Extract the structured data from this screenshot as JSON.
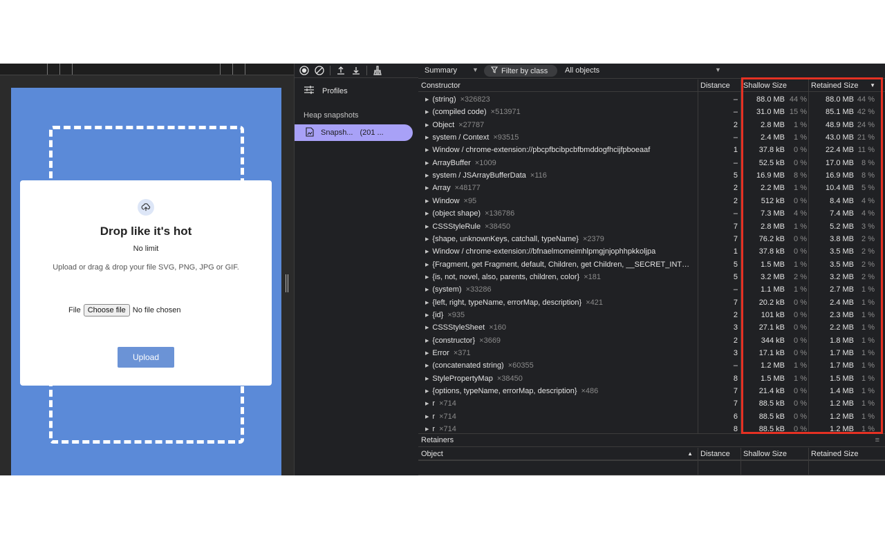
{
  "modal": {
    "title": "Drop like it's hot",
    "limit": "No limit",
    "description": "Upload or drag & drop your file SVG, PNG, JPG or GIF.",
    "file_label": "File",
    "choose_file": "Choose file",
    "no_file": "No file chosen",
    "upload": "Upload"
  },
  "sidebar": {
    "profiles": "Profiles",
    "heap_snapshots": "Heap snapshots",
    "snapshot_name": "Snapsh...",
    "snapshot_size": "(201 ..."
  },
  "toolbar": {
    "view": "Summary",
    "filter": "Filter by class",
    "objects": "All objects"
  },
  "headers": {
    "constructor": "Constructor",
    "distance": "Distance",
    "shallow": "Shallow Size",
    "retained": "Retained Size",
    "object": "Object"
  },
  "retainers_title": "Retainers",
  "rows": [
    {
      "name": "(string)",
      "count": "×326823",
      "distance": "–",
      "shallow": "88.0 MB",
      "shallow_pct": "44 %",
      "retained": "88.0 MB",
      "retained_pct": "44 %"
    },
    {
      "name": "(compiled code)",
      "count": "×513971",
      "distance": "–",
      "shallow": "31.0 MB",
      "shallow_pct": "15 %",
      "retained": "85.1 MB",
      "retained_pct": "42 %"
    },
    {
      "name": "Object",
      "count": "×27787",
      "distance": "2",
      "shallow": "2.8 MB",
      "shallow_pct": "1 %",
      "retained": "48.9 MB",
      "retained_pct": "24 %"
    },
    {
      "name": "system / Context",
      "count": "×93515",
      "distance": "–",
      "shallow": "2.4 MB",
      "shallow_pct": "1 %",
      "retained": "43.0 MB",
      "retained_pct": "21 %"
    },
    {
      "name": "Window / chrome-extension://pbcpfbcibpcbfbmddogfhcijfpboeaaf",
      "count": "",
      "distance": "1",
      "shallow": "37.8 kB",
      "shallow_pct": "0 %",
      "retained": "22.4 MB",
      "retained_pct": "11 %"
    },
    {
      "name": "ArrayBuffer",
      "count": "×1009",
      "distance": "–",
      "shallow": "52.5 kB",
      "shallow_pct": "0 %",
      "retained": "17.0 MB",
      "retained_pct": "8 %"
    },
    {
      "name": "system / JSArrayBufferData",
      "count": "×116",
      "distance": "5",
      "shallow": "16.9 MB",
      "shallow_pct": "8 %",
      "retained": "16.9 MB",
      "retained_pct": "8 %"
    },
    {
      "name": "Array",
      "count": "×48177",
      "distance": "2",
      "shallow": "2.2 MB",
      "shallow_pct": "1 %",
      "retained": "10.4 MB",
      "retained_pct": "5 %"
    },
    {
      "name": "Window",
      "count": "×95",
      "distance": "2",
      "shallow": "512 kB",
      "shallow_pct": "0 %",
      "retained": "8.4 MB",
      "retained_pct": "4 %"
    },
    {
      "name": "(object shape)",
      "count": "×136786",
      "distance": "–",
      "shallow": "7.3 MB",
      "shallow_pct": "4 %",
      "retained": "7.4 MB",
      "retained_pct": "4 %"
    },
    {
      "name": "CSSStyleRule",
      "count": "×38450",
      "distance": "7",
      "shallow": "2.8 MB",
      "shallow_pct": "1 %",
      "retained": "5.2 MB",
      "retained_pct": "3 %"
    },
    {
      "name": "{shape, unknownKeys, catchall, typeName}",
      "count": "×2379",
      "distance": "7",
      "shallow": "76.2 kB",
      "shallow_pct": "0 %",
      "retained": "3.8 MB",
      "retained_pct": "2 %"
    },
    {
      "name": "Window / chrome-extension://bfnaelmomeimhlpmgjnjophhpkkoljpa",
      "count": "",
      "distance": "1",
      "shallow": "37.8 kB",
      "shallow_pct": "0 %",
      "retained": "3.5 MB",
      "retained_pct": "2 %"
    },
    {
      "name": "{Fragment, get Fragment, default, Children, get Children, __SECRET_INT…",
      "count": "",
      "distance": "5",
      "shallow": "1.5 MB",
      "shallow_pct": "1 %",
      "retained": "3.5 MB",
      "retained_pct": "2 %"
    },
    {
      "name": "{is, not, novel, also, parents, children, color}",
      "count": "×181",
      "distance": "5",
      "shallow": "3.2 MB",
      "shallow_pct": "2 %",
      "retained": "3.2 MB",
      "retained_pct": "2 %"
    },
    {
      "name": "(system)",
      "count": "×33286",
      "distance": "–",
      "shallow": "1.1 MB",
      "shallow_pct": "1 %",
      "retained": "2.7 MB",
      "retained_pct": "1 %"
    },
    {
      "name": "{left, right, typeName, errorMap, description}",
      "count": "×421",
      "distance": "7",
      "shallow": "20.2 kB",
      "shallow_pct": "0 %",
      "retained": "2.4 MB",
      "retained_pct": "1 %"
    },
    {
      "name": "{id}",
      "count": "×935",
      "distance": "2",
      "shallow": "101 kB",
      "shallow_pct": "0 %",
      "retained": "2.3 MB",
      "retained_pct": "1 %"
    },
    {
      "name": "CSSStyleSheet",
      "count": "×160",
      "distance": "3",
      "shallow": "27.1 kB",
      "shallow_pct": "0 %",
      "retained": "2.2 MB",
      "retained_pct": "1 %"
    },
    {
      "name": "{constructor}",
      "count": "×3669",
      "distance": "2",
      "shallow": "344 kB",
      "shallow_pct": "0 %",
      "retained": "1.8 MB",
      "retained_pct": "1 %"
    },
    {
      "name": "Error",
      "count": "×371",
      "distance": "3",
      "shallow": "17.1 kB",
      "shallow_pct": "0 %",
      "retained": "1.7 MB",
      "retained_pct": "1 %"
    },
    {
      "name": "(concatenated string)",
      "count": "×60355",
      "distance": "–",
      "shallow": "1.2 MB",
      "shallow_pct": "1 %",
      "retained": "1.7 MB",
      "retained_pct": "1 %"
    },
    {
      "name": "StylePropertyMap",
      "count": "×38450",
      "distance": "8",
      "shallow": "1.5 MB",
      "shallow_pct": "1 %",
      "retained": "1.5 MB",
      "retained_pct": "1 %"
    },
    {
      "name": "{options, typeName, errorMap, description}",
      "count": "×486",
      "distance": "7",
      "shallow": "21.4 kB",
      "shallow_pct": "0 %",
      "retained": "1.4 MB",
      "retained_pct": "1 %"
    },
    {
      "name": "r",
      "count": "×714",
      "distance": "7",
      "shallow": "88.5 kB",
      "shallow_pct": "0 %",
      "retained": "1.2 MB",
      "retained_pct": "1 %"
    },
    {
      "name": "r",
      "count": "×714",
      "distance": "6",
      "shallow": "88.5 kB",
      "shallow_pct": "0 %",
      "retained": "1.2 MB",
      "retained_pct": "1 %"
    },
    {
      "name": "r",
      "count": "×714",
      "distance": "8",
      "shallow": "88.5 kB",
      "shallow_pct": "0 %",
      "retained": "1.2 MB",
      "retained_pct": "1 %"
    }
  ],
  "colors": {
    "page_background": "#5b8ad8",
    "upload_button": "#6b93d6",
    "selected_snapshot": "#a8a1f7",
    "highlight": "#e53123",
    "devtools_background": "#202124"
  },
  "icons": [
    "record-icon",
    "clear-icon",
    "upload-icon",
    "download-icon",
    "broom-icon",
    "tune-icon",
    "file-snapshot-icon",
    "filter-icon",
    "cloud-upload-icon",
    "sort-desc-icon",
    "sort-asc-icon",
    "menu-icon"
  ]
}
